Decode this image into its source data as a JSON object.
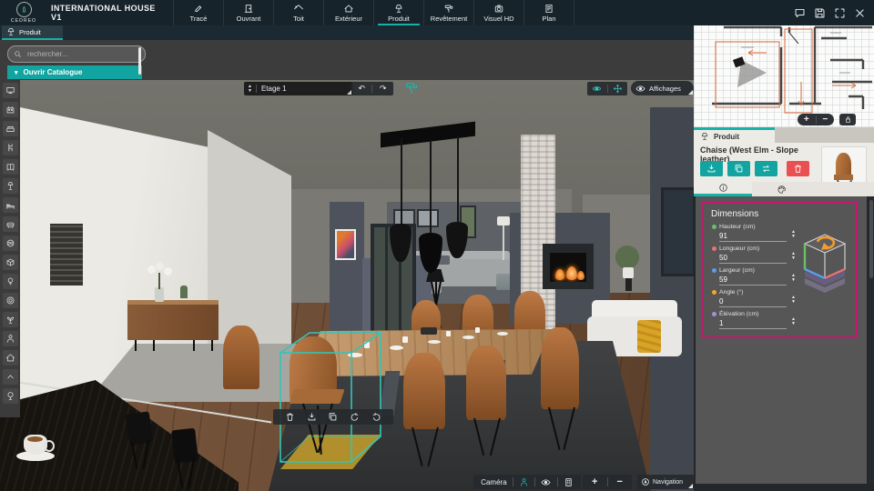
{
  "app": {
    "brand": "CEDREO",
    "title": "INTERNATIONAL HOUSE V1"
  },
  "topbar": {
    "menu": [
      {
        "id": "trace",
        "label": "Tracé",
        "icon": "pencil",
        "active": false
      },
      {
        "id": "ouvrant",
        "label": "Ouvrant",
        "icon": "door",
        "active": false
      },
      {
        "id": "toit",
        "label": "Toit",
        "icon": "roof",
        "active": false
      },
      {
        "id": "exterieur",
        "label": "Extérieur",
        "icon": "house",
        "active": false
      },
      {
        "id": "produit",
        "label": "Produit",
        "icon": "lamp",
        "active": true
      },
      {
        "id": "revetement",
        "label": "Revêtement",
        "icon": "roller",
        "active": false
      },
      {
        "id": "visuel-hd",
        "label": "Visuel HD",
        "icon": "camera",
        "active": false
      },
      {
        "id": "plan",
        "label": "Plan",
        "icon": "document",
        "active": false
      }
    ],
    "window_buttons": [
      {
        "id": "comments",
        "icon": "chat"
      },
      {
        "id": "save",
        "icon": "save"
      },
      {
        "id": "fullscreen",
        "icon": "expand"
      },
      {
        "id": "close",
        "icon": "close"
      }
    ]
  },
  "left_panel": {
    "tab_label": "Produit",
    "search_placeholder": "rechercher...",
    "catalog_button": "Ouvrir Catalogue"
  },
  "sidebar": {
    "items": [
      {
        "id": "media",
        "icon": "tv"
      },
      {
        "id": "kitchen",
        "icon": "stove"
      },
      {
        "id": "sofas",
        "icon": "sofa"
      },
      {
        "id": "chairs",
        "icon": "chair"
      },
      {
        "id": "storage",
        "icon": "cabinet"
      },
      {
        "id": "floor-lamps",
        "icon": "flamp"
      },
      {
        "id": "beds",
        "icon": "bed"
      },
      {
        "id": "armchairs",
        "icon": "armchair"
      },
      {
        "id": "decoration",
        "icon": "ball"
      },
      {
        "id": "boxes",
        "icon": "box"
      },
      {
        "id": "lighting",
        "icon": "bulb"
      },
      {
        "id": "tableware",
        "icon": "plate"
      },
      {
        "id": "plants",
        "icon": "plant"
      },
      {
        "id": "characters",
        "icon": "person"
      },
      {
        "id": "exterior",
        "icon": "house"
      },
      {
        "id": "collapse",
        "icon": "chevup"
      },
      {
        "id": "garden",
        "icon": "tree"
      }
    ]
  },
  "viewport": {
    "floor_selector_label": "Etage 1",
    "affichages_label": "Affichages",
    "selection_toolbar": [
      {
        "id": "delete",
        "icon": "trash"
      },
      {
        "id": "download",
        "icon": "download"
      },
      {
        "id": "duplicate",
        "icon": "copy"
      },
      {
        "id": "rotate-left",
        "icon": "rotl"
      },
      {
        "id": "rotate-right",
        "icon": "rotr"
      }
    ],
    "camera_label": "Caméra",
    "zoom_in": "+",
    "zoom_out": "−",
    "navigation_label": "Navigation",
    "undo_glyph": "↶",
    "redo_glyph": "↷"
  },
  "minimap": {
    "zoom_in": "+",
    "zoom_out": "−"
  },
  "right_panel": {
    "tab_label": "Produit",
    "product_title": "Chaise (West Elm - Slope leather)",
    "dimensions": {
      "title": "Dimensions",
      "fields": [
        {
          "label": "Hauteur (cm)",
          "value": "91",
          "color": "#6abf69"
        },
        {
          "label": "Longueur (cm)",
          "value": "50",
          "color": "#e57373"
        },
        {
          "label": "Largeur (cm)",
          "value": "59",
          "color": "#5c9ded"
        },
        {
          "label": "Angle (°)",
          "value": "0",
          "color": "#f5a623"
        },
        {
          "label": "Élévation (cm)",
          "value": "1",
          "color": "#a98fd6"
        }
      ]
    }
  },
  "colors": {
    "accent": "#17b1a7",
    "highlight": "#c9156f",
    "danger": "#ea5052",
    "selection": "#35c4b5"
  }
}
